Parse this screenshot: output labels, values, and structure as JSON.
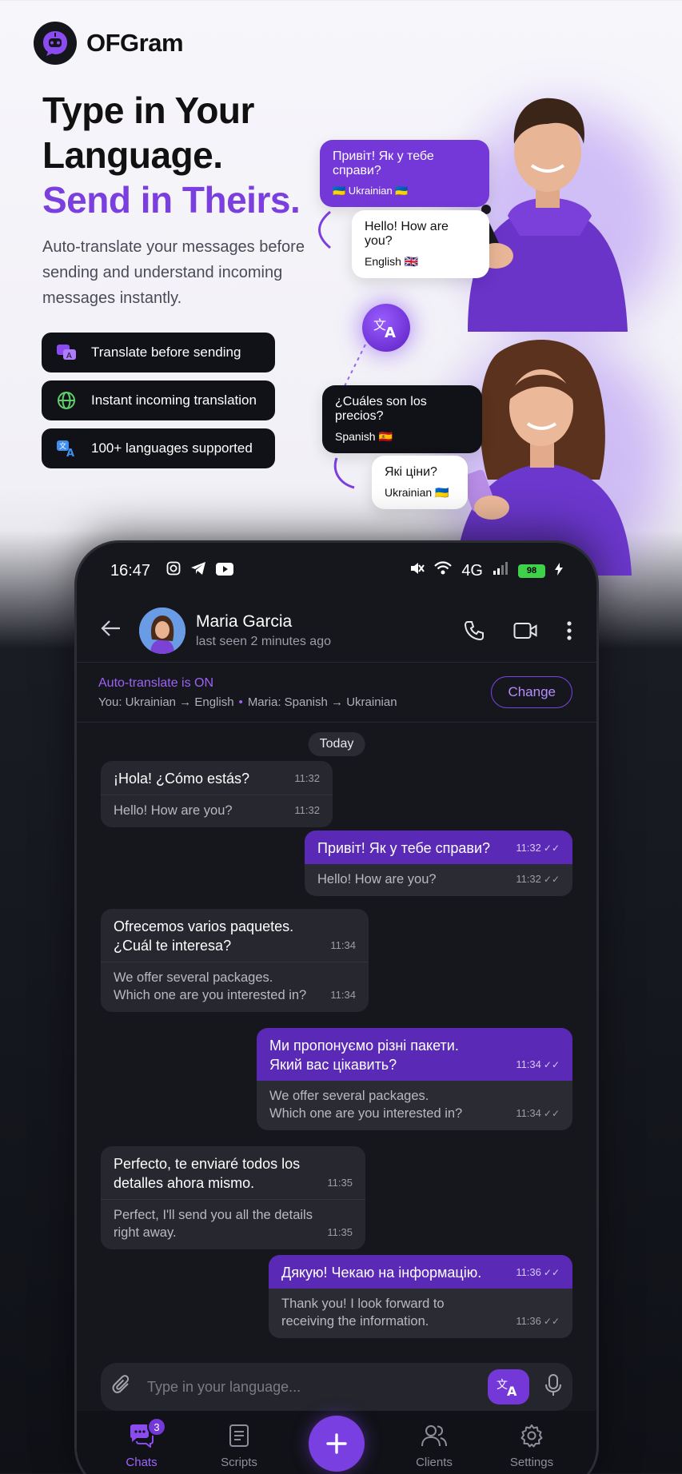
{
  "brand": {
    "name": "OFGram"
  },
  "hero": {
    "headline_line1": "Type in Your",
    "headline_line2": "Language.",
    "headline_accent": "Send in Theirs.",
    "subtext": "Auto-translate your messages before sending and understand incoming messages instantly.",
    "features": [
      {
        "label": "Translate before sending",
        "icon": "translate-chat-icon"
      },
      {
        "label": "Instant incoming translation",
        "icon": "globe-icon"
      },
      {
        "label": "100+ languages supported",
        "icon": "language-icon"
      }
    ],
    "bubbles": {
      "uk_text": "Привіт! Як у тебе справи?",
      "uk_lang": "🇺🇦 Ukrainian 🇺🇦",
      "en_text": "Hello! How are you?",
      "en_lang": "English 🇬🇧",
      "es_text": "¿Cuáles son los precios?",
      "es_lang": "Spanish 🇪🇸",
      "uk2_text": "Які ціни?",
      "uk2_lang": "Ukrainian 🇺🇦"
    }
  },
  "status_bar": {
    "time": "16:47",
    "network": "4G",
    "battery": "98"
  },
  "chat": {
    "contact_name": "Maria Garcia",
    "last_seen": "last seen 2 minutes ago",
    "translate_status": "Auto-translate is ON",
    "pair_you": "You: Ukrainian → English",
    "pair_contact": "Maria: Spanish → Ukrainian",
    "change_label": "Change",
    "day_label": "Today",
    "messages": [
      {
        "dir": "in",
        "orig": "¡Hola! ¿Cómo estás?",
        "orig_time": "11:32",
        "trans": "Hello! How are you?",
        "trans_time": "11:32"
      },
      {
        "dir": "out",
        "orig": "Привіт! Як у тебе справи?",
        "orig_time": "11:32",
        "trans": "Hello! How are you?",
        "trans_time": "11:32"
      },
      {
        "dir": "in",
        "orig": "Ofrecemos varios paquetes.\n¿Cuál te interesa?",
        "orig_time": "11:34",
        "trans": "We offer several packages.\nWhich one are you interested in?",
        "trans_time": "11:34"
      },
      {
        "dir": "out",
        "orig": "Ми пропонуємо різні пакети.\nЯкий вас цікавить?",
        "orig_time": "11:34",
        "trans": "We offer several packages.\nWhich one are you interested in?",
        "trans_time": "11:34"
      },
      {
        "dir": "in",
        "orig": "Perfecto, te enviaré todos los\ndetalles ahora mismo.",
        "orig_time": "11:35",
        "trans": "Perfect, I'll send you all the details\nright away.",
        "trans_time": "11:35"
      },
      {
        "dir": "out",
        "orig": "Дякую! Чекаю на інформацію.",
        "orig_time": "11:36",
        "trans": "Thank you! I look forward to\nreceiving the information.",
        "trans_time": "11:36"
      }
    ],
    "composer_placeholder": "Type in your language..."
  },
  "nav": {
    "chats": "Chats",
    "chats_badge": "3",
    "scripts": "Scripts",
    "clients": "Clients",
    "settings": "Settings"
  },
  "colors": {
    "accent": "#7438d8",
    "accent_light": "#9d62f5",
    "dark_bg": "#16171d"
  }
}
